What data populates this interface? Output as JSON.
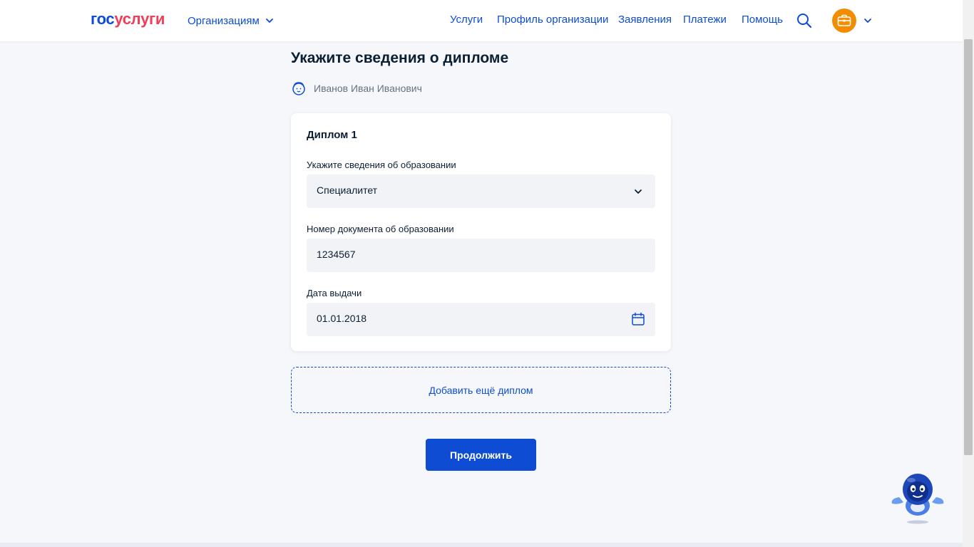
{
  "header": {
    "logo_part1": "гос",
    "logo_part2": "услуги",
    "org_menu_label": "Организациям",
    "nav": [
      "Услуги",
      "Профиль организации",
      "Заявления",
      "Платежи",
      "Помощь"
    ],
    "icons": {
      "search": "search-icon",
      "avatar": "briefcase-icon",
      "chevron": "chevron-down-icon"
    }
  },
  "page": {
    "title": "Укажите сведения о дипломе",
    "user_name": "Иванов Иван Иванович"
  },
  "diploma_card": {
    "title": "Диплом 1",
    "education_label": "Укажите сведения об образовании",
    "education_value": "Специалитет",
    "doc_number_label": "Номер документа об образовании",
    "doc_number_value": "1234567",
    "issue_date_label": "Дата выдачи",
    "issue_date_value": "01.01.2018"
  },
  "actions": {
    "add_diploma": "Добавить ещё диплом",
    "continue": "Продолжить"
  },
  "colors": {
    "accent": "#0d4cd3",
    "logo_red": "#ee3f58",
    "avatar_bg": "#f28c00",
    "page_bg": "#f5f7fb"
  }
}
